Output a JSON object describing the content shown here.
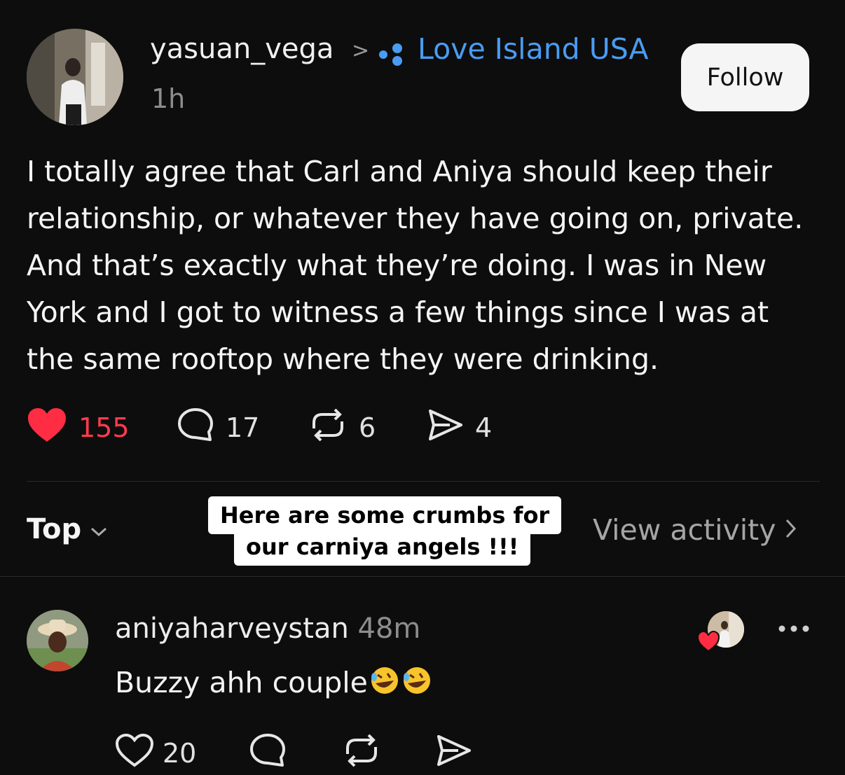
{
  "post": {
    "author": "yasuan_vega",
    "separator": ">",
    "community": "Love Island USA",
    "time": "1h",
    "follow_label": "Follow",
    "body": "I totally agree that Carl and Aniya should keep their relationship, or whatever they have going on, private. And that’s exactly what they’re doing. I was in New York and I got to witness a few things since I was at the same rooftop where they were drinking.",
    "likes": "155",
    "replies": "17",
    "reposts": "6",
    "shares": "4"
  },
  "sort": {
    "label": "Top"
  },
  "activity": {
    "label": "View activity"
  },
  "caption": {
    "line1": "Here are some crumbs for",
    "line2": "our carniya angels !!!"
  },
  "comment": {
    "author": "aniyaharveystan",
    "time": "48m",
    "text": "Buzzy ahh couple",
    "likes": "20"
  },
  "colors": {
    "background": "#0d0d0d",
    "accent_blue": "#4a9cf2",
    "like_red": "#ff3b4e",
    "follow_button": "#f5f5f5"
  },
  "icons": [
    "community-icon",
    "chevron-right-icon",
    "heart-filled-icon",
    "reply-icon",
    "repost-icon",
    "share-icon",
    "chevron-down-icon",
    "laughing-emoji-icon",
    "heart-outline-icon",
    "more-icon"
  ]
}
